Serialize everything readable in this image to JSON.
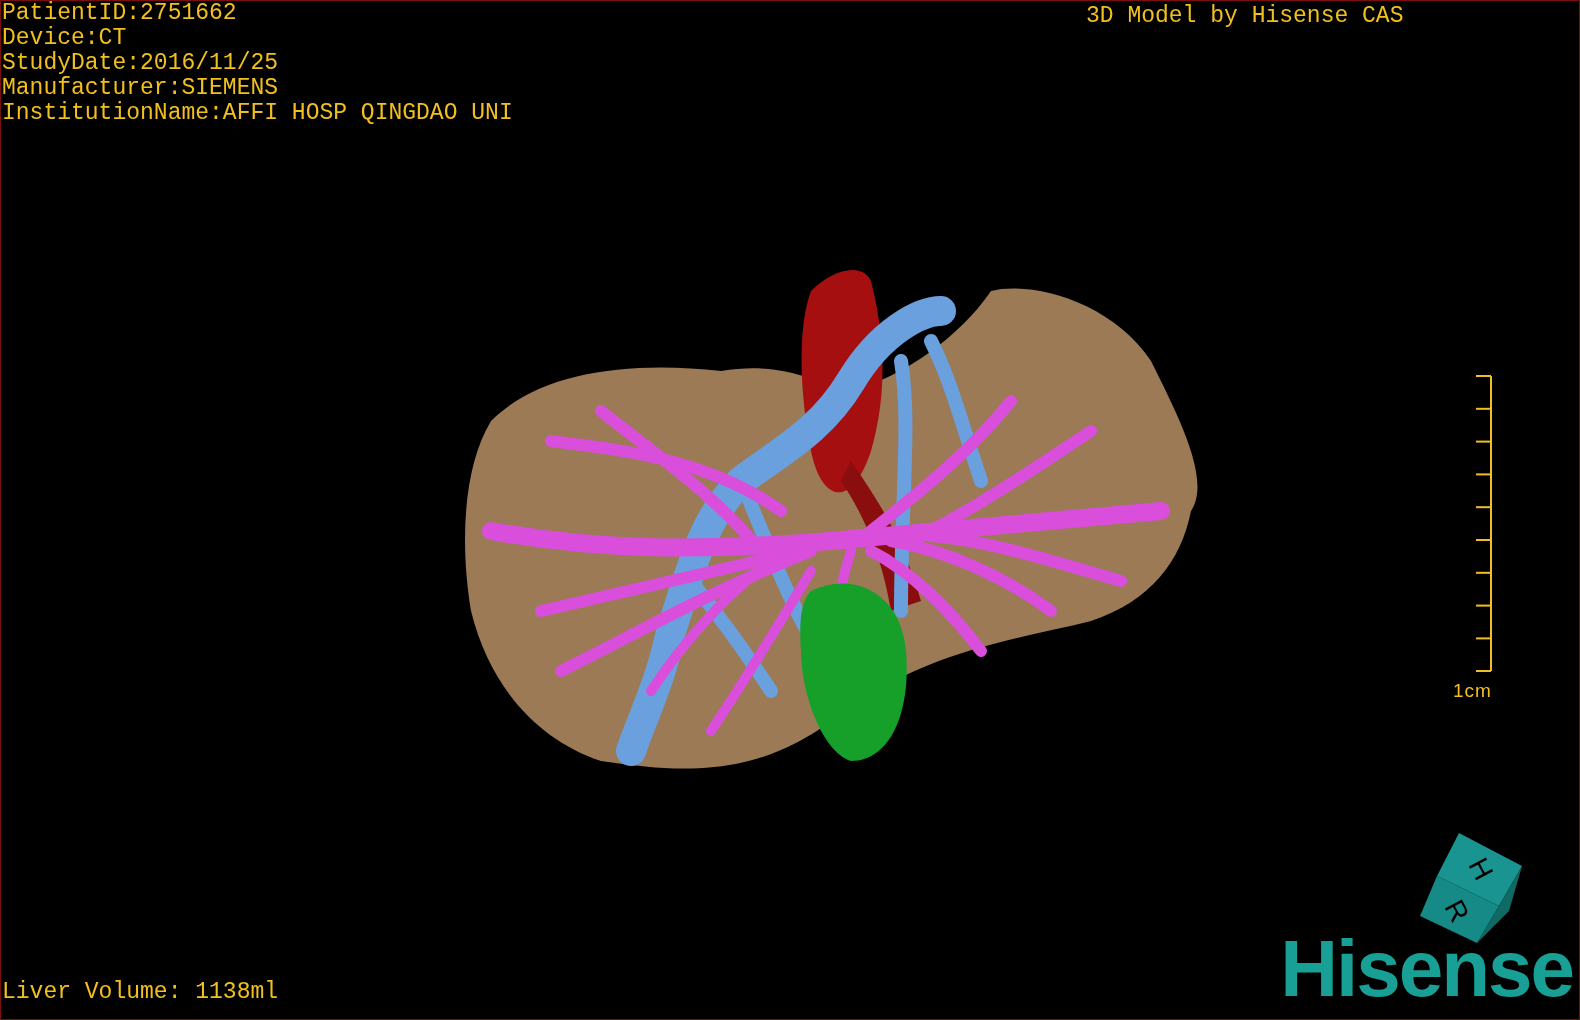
{
  "patient_info": [
    "PatientID:2751662",
    "Device:CT",
    "StudyDate:2016/11/25",
    "Manufacturer:SIEMENS",
    "InstitutionName:AFFI HOSP QINGDAO UNI"
  ],
  "model_credit": "3D Model by Hisense CAS",
  "scale_bar": {
    "label": "1cm"
  },
  "orientation_cube": {
    "faces": [
      "H",
      "R"
    ]
  },
  "logo": "Hisense",
  "footer": "Liver Volume: 1138ml"
}
